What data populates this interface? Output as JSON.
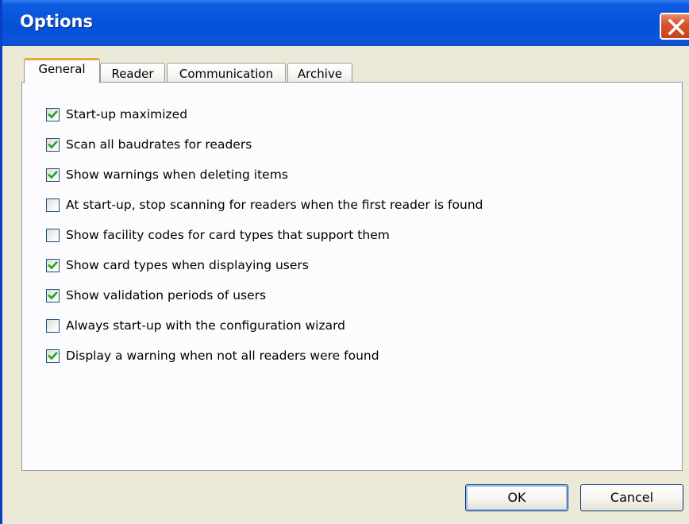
{
  "window": {
    "title": "Options",
    "close_icon": "close-x-icon"
  },
  "tabs": [
    {
      "label": "General",
      "active": true
    },
    {
      "label": "Reader",
      "active": false
    },
    {
      "label": "Communication",
      "active": false
    },
    {
      "label": "Archive",
      "active": false
    }
  ],
  "options": [
    {
      "label": "Start-up maximized",
      "checked": true
    },
    {
      "label": "Scan all baudrates for readers",
      "checked": true
    },
    {
      "label": "Show warnings when deleting items",
      "checked": true
    },
    {
      "label": "At start-up, stop scanning for readers when the first reader is found",
      "checked": false
    },
    {
      "label": "Show facility codes for card types that support them",
      "checked": false
    },
    {
      "label": "Show card types when displaying users",
      "checked": true
    },
    {
      "label": "Show validation periods of users",
      "checked": true
    },
    {
      "label": "Always start-up with the configuration wizard",
      "checked": false
    },
    {
      "label": "Display a warning when not all readers were found",
      "checked": true
    }
  ],
  "buttons": {
    "ok_label": "OK",
    "cancel_label": "Cancel"
  },
  "colors": {
    "titlebar": "#0654da",
    "checkmark": "#21a121",
    "active_tab_accent": "#e7a640"
  }
}
